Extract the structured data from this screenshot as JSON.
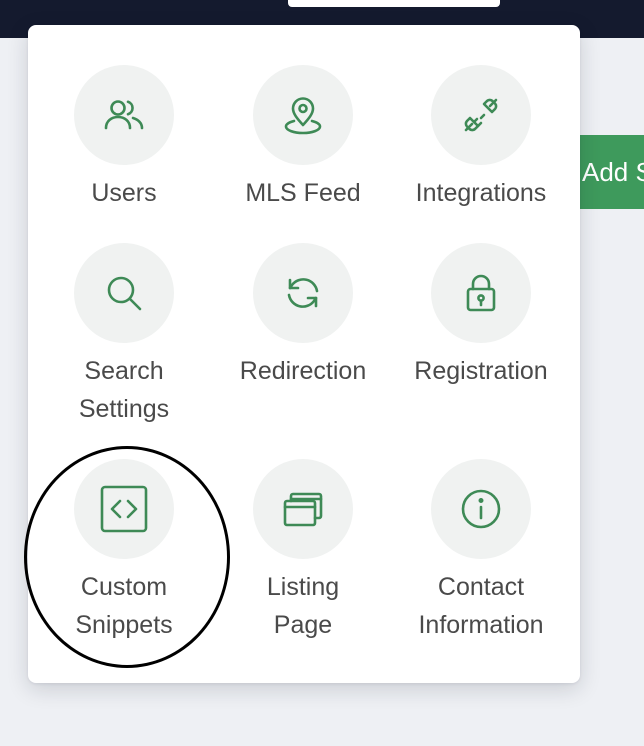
{
  "add_button": {
    "label": "Add S"
  },
  "menu": {
    "items": [
      {
        "label": "Users",
        "icon": "users-icon"
      },
      {
        "label": "MLS Feed",
        "icon": "map-pin-icon"
      },
      {
        "label": "Integrations",
        "icon": "plug-icon"
      },
      {
        "label": "Search\nSettings",
        "icon": "search-icon"
      },
      {
        "label": "Redirection",
        "icon": "refresh-icon"
      },
      {
        "label": "Registration",
        "icon": "lock-icon"
      },
      {
        "label": "Custom\nSnippets",
        "icon": "code-icon"
      },
      {
        "label": "Listing\nPage",
        "icon": "windows-icon"
      },
      {
        "label": "Contact\nInformation",
        "icon": "info-icon"
      }
    ]
  },
  "colors": {
    "accent": "#3e9a5c",
    "icon_stroke": "#3e8a56",
    "icon_circle": "#f0f2f1",
    "label_text": "#4a4a4a",
    "topbar": "#141a2e"
  }
}
